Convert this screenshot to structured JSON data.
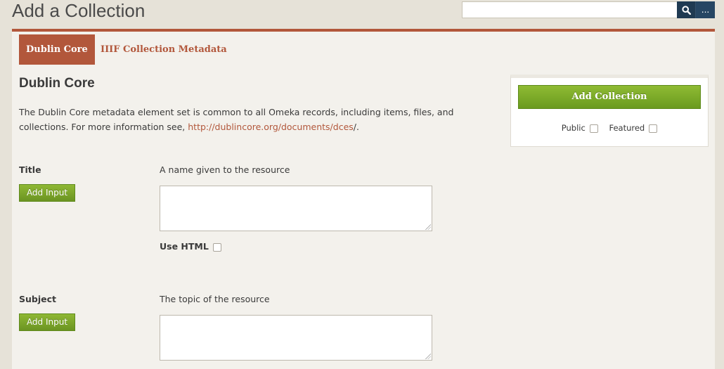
{
  "page": {
    "title": "Add a Collection"
  },
  "search": {
    "placeholder": "",
    "search_icon": "search-icon",
    "advanced_label": "..."
  },
  "tabs": [
    {
      "label": "Dublin Core",
      "active": true
    },
    {
      "label": "IIIF Collection Metadata",
      "active": false
    }
  ],
  "section": {
    "title": "Dublin Core",
    "description_prefix": "The Dublin Core metadata element set is common to all Omeka records, including items, files, and collections. For more information see, ",
    "description_link": "http://dublincore.org/documents/dces",
    "description_suffix": "/."
  },
  "fields": [
    {
      "label": "Title",
      "description": "A name given to the resource",
      "add_input_label": "Add Input",
      "use_html_label": "Use HTML"
    },
    {
      "label": "Subject",
      "description": "The topic of the resource",
      "add_input_label": "Add Input"
    }
  ],
  "save_panel": {
    "button_label": "Add Collection",
    "public_label": "Public",
    "featured_label": "Featured"
  },
  "colors": {
    "accent": "#b2573b",
    "button_green": "#7aa829",
    "search_button": "#1f3a52"
  }
}
